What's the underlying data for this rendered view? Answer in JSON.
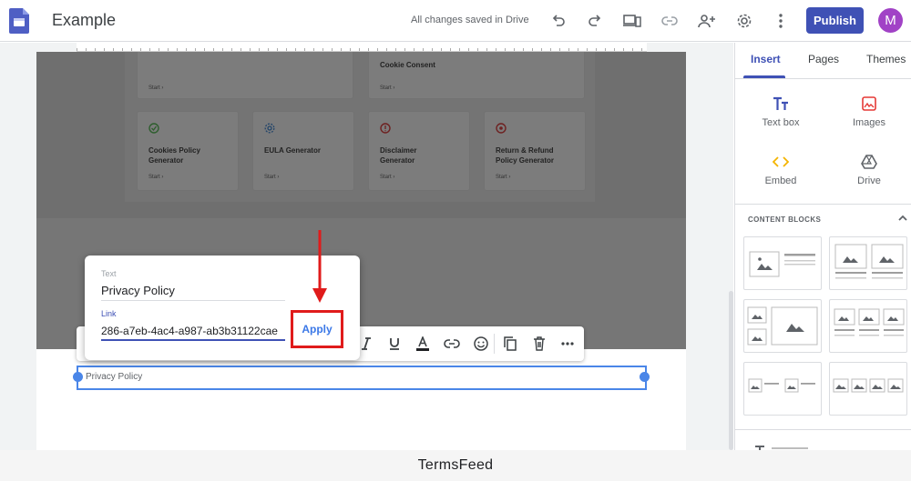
{
  "app": {
    "title": "Example",
    "save_status": "All changes saved in Drive",
    "publish_label": "Publish",
    "avatar_letter": "M",
    "accent": "#3f51b5",
    "avatar_color": "#a142c6"
  },
  "cards": {
    "row1": [
      {
        "title": "",
        "start": "Start ›"
      },
      {
        "title": "Cookie Consent",
        "start": "Start ›"
      }
    ],
    "row2": [
      {
        "title_line1": "Cookies Policy",
        "title_line2": "Generator",
        "start": "Start ›",
        "icon": "cookie-icon"
      },
      {
        "title_line1": "EULA Generator",
        "title_line2": "",
        "start": "Start ›",
        "icon": "gear-icon"
      },
      {
        "title_line1": "Disclaimer",
        "title_line2": "Generator",
        "start": "Start ›",
        "icon": "alert-icon"
      },
      {
        "title_line1": "Return & Refund",
        "title_line2": "Policy Generator",
        "start": "Start ›",
        "icon": "refund-icon"
      }
    ]
  },
  "textbox": {
    "text": "Privacy Policy"
  },
  "link_popup": {
    "text_label": "Text",
    "text_value": "Privacy Policy",
    "link_label": "Link",
    "link_value": "286-a7eb-4ac4-a987-ab3b31122cae",
    "apply_label": "Apply",
    "highlight_color": "#e01b1b"
  },
  "panel": {
    "tabs": [
      "Insert",
      "Pages",
      "Themes"
    ],
    "insert_items": [
      {
        "label": "Text box",
        "icon": "text-box-icon"
      },
      {
        "label": "Images",
        "icon": "image-icon"
      },
      {
        "label": "Embed",
        "icon": "embed-icon"
      },
      {
        "label": "Drive",
        "icon": "drive-icon"
      }
    ],
    "content_blocks_label": "CONTENT BLOCKS"
  },
  "footer": {
    "text": "TermsFeed"
  }
}
